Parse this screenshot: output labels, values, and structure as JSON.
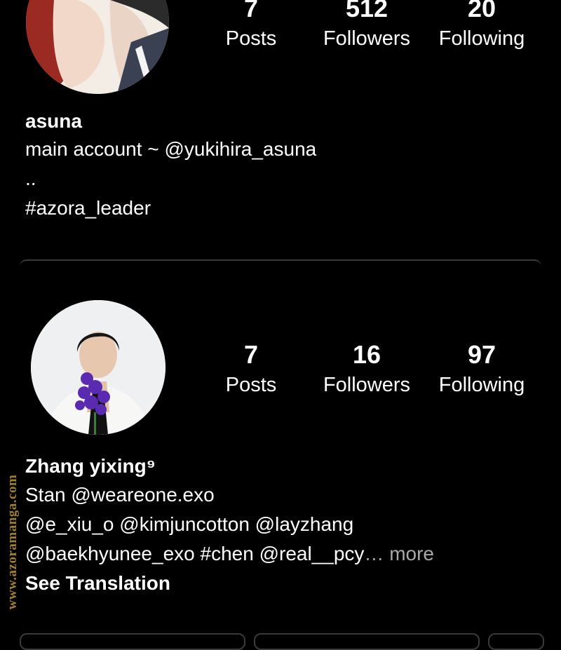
{
  "profiles": [
    {
      "stats": {
        "posts": {
          "value": "7",
          "label": "Posts"
        },
        "followers": {
          "value": "512",
          "label": "Followers"
        },
        "following": {
          "value": "20",
          "label": "Following"
        }
      },
      "name": "asuna",
      "bio": [
        "main account ~ @yukihira_asuna",
        "..",
        "#azora_leader"
      ]
    },
    {
      "stats": {
        "posts": {
          "value": "7",
          "label": "Posts"
        },
        "followers": {
          "value": "16",
          "label": "Followers"
        },
        "following": {
          "value": "97",
          "label": "Following"
        }
      },
      "name": "Zhang yixing⁹",
      "bio": [
        "Stan @weareone.exo",
        "@e_xiu_o @kimjuncotton @layzhang",
        "@baekhyunee_exo #chen @real__pcy"
      ],
      "more_ellipsis": "…",
      "more_label": "more",
      "see_translation": "See Translation"
    }
  ],
  "watermark": "www.azoramanga.com",
  "colors": {
    "background": "#000000",
    "text": "#ffffff",
    "muted": "#a8a8a8",
    "divider": "#3a3a3a",
    "watermark": "#a0802e"
  }
}
